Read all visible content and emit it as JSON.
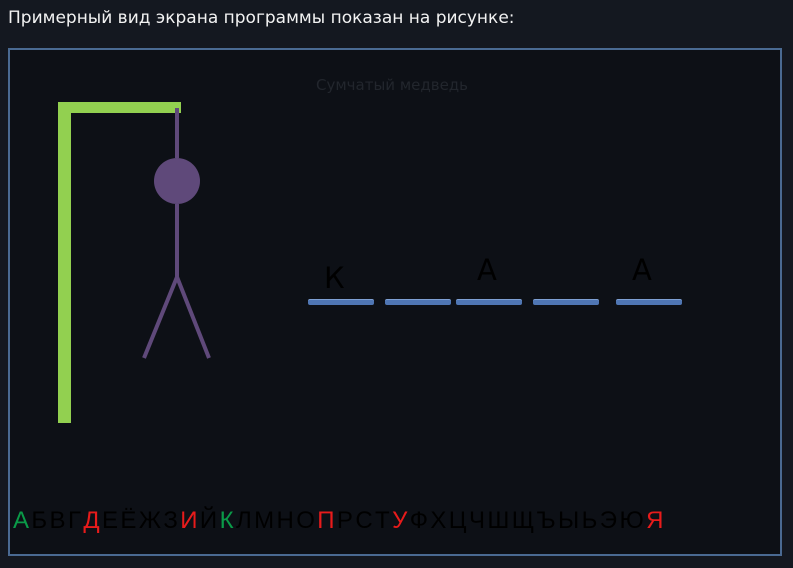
{
  "caption": "Примерный вид экрана программы показан на рисунке:",
  "game": {
    "hint": "Сумчатый медведь",
    "word_slots": [
      "К",
      "",
      "А",
      "",
      "А"
    ],
    "alphabet": [
      {
        "letter": "А",
        "state": "hit"
      },
      {
        "letter": "Б",
        "state": "unused"
      },
      {
        "letter": "В",
        "state": "unused"
      },
      {
        "letter": "Г",
        "state": "unused"
      },
      {
        "letter": "Д",
        "state": "miss"
      },
      {
        "letter": "Е",
        "state": "unused"
      },
      {
        "letter": "Ё",
        "state": "unused"
      },
      {
        "letter": "Ж",
        "state": "unused"
      },
      {
        "letter": "З",
        "state": "unused"
      },
      {
        "letter": "И",
        "state": "miss"
      },
      {
        "letter": "Й",
        "state": "unused"
      },
      {
        "letter": "К",
        "state": "hit"
      },
      {
        "letter": "Л",
        "state": "unused"
      },
      {
        "letter": "М",
        "state": "unused"
      },
      {
        "letter": "Н",
        "state": "unused"
      },
      {
        "letter": "О",
        "state": "unused"
      },
      {
        "letter": "П",
        "state": "miss"
      },
      {
        "letter": "Р",
        "state": "unused"
      },
      {
        "letter": "С",
        "state": "unused"
      },
      {
        "letter": "Т",
        "state": "unused"
      },
      {
        "letter": "У",
        "state": "miss"
      },
      {
        "letter": "Ф",
        "state": "unused"
      },
      {
        "letter": "Х",
        "state": "unused"
      },
      {
        "letter": "Ц",
        "state": "unused"
      },
      {
        "letter": "Ч",
        "state": "unused"
      },
      {
        "letter": "Ш",
        "state": "unused"
      },
      {
        "letter": "Щ",
        "state": "unused"
      },
      {
        "letter": "Ъ",
        "state": "unused"
      },
      {
        "letter": "Ы",
        "state": "unused"
      },
      {
        "letter": "Ь",
        "state": "unused"
      },
      {
        "letter": "Э",
        "state": "unused"
      },
      {
        "letter": "Ю",
        "state": "unused"
      },
      {
        "letter": "Я",
        "state": "miss"
      }
    ]
  },
  "colors": {
    "gallows": "#92d050",
    "figure": "#5f497a",
    "slot": "#4f76b4",
    "hit": "#0a9a48",
    "miss": "#e81b1b"
  }
}
